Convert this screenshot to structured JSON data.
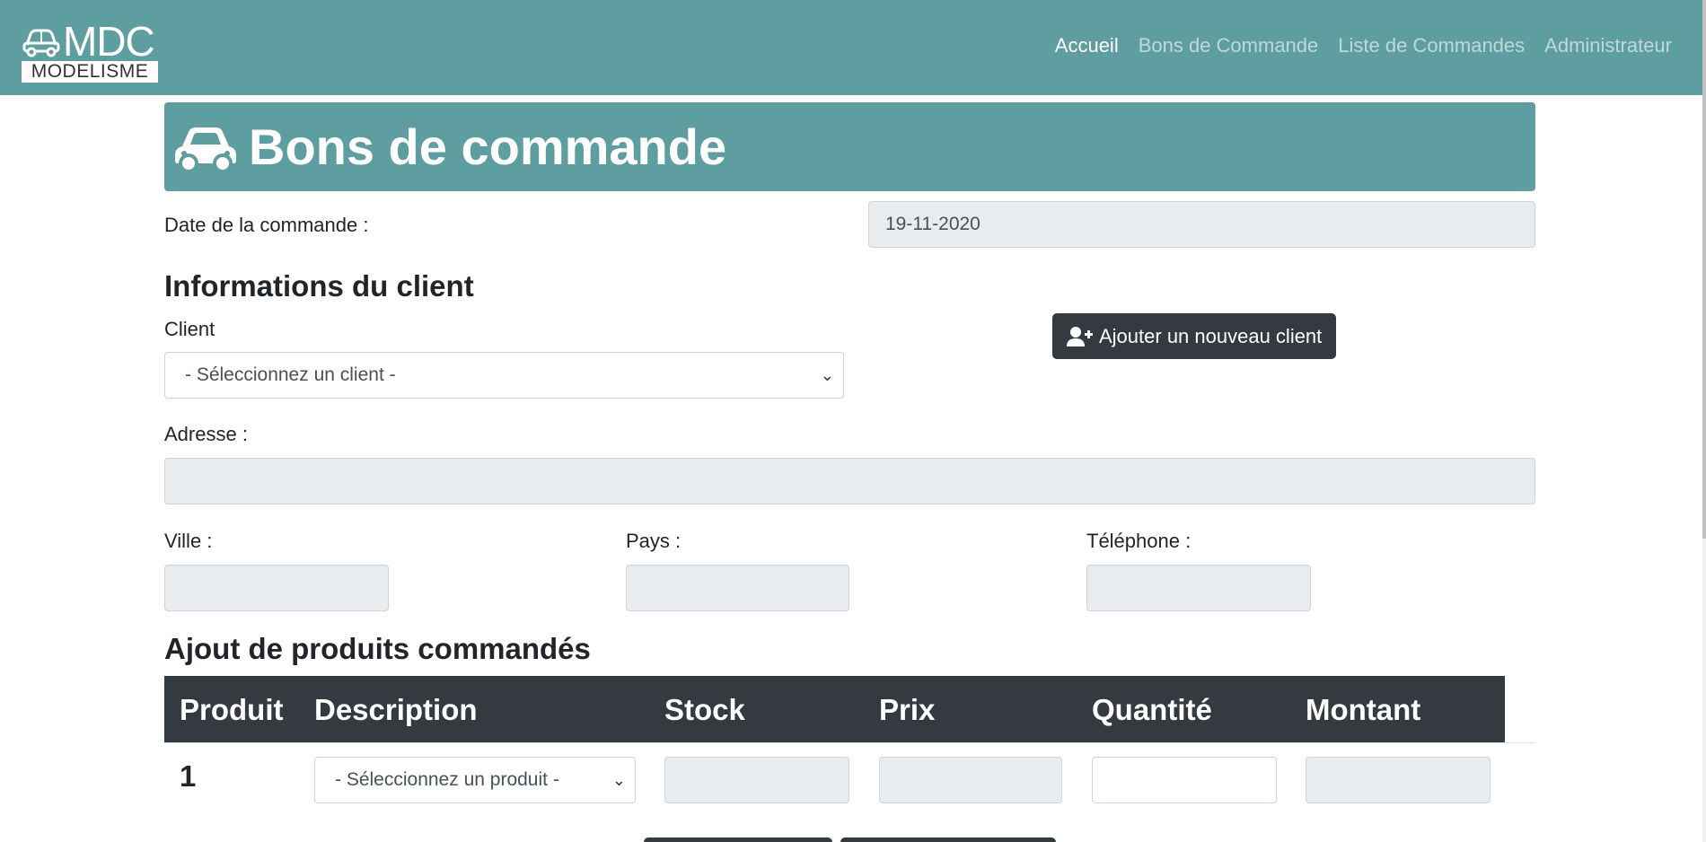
{
  "navbar": {
    "logo_text": "MDC",
    "logo_sub": "MODELISME",
    "links": [
      {
        "label": "Accueil",
        "active": true
      },
      {
        "label": "Bons de Commande",
        "active": false
      },
      {
        "label": "Liste de Commandes",
        "active": false
      },
      {
        "label": "Administrateur",
        "active": false
      }
    ]
  },
  "banner": {
    "icon": "car-icon",
    "title": "Bons de commande"
  },
  "order": {
    "date_label": "Date de la commande :",
    "date_value": "19-11-2020"
  },
  "client_section": {
    "heading": "Informations du client",
    "client_label": "Client",
    "client_select": "- Séleccionnez un client -",
    "add_client_button": "Ajouter un nouveau client",
    "address_label": "Adresse :",
    "address_value": "",
    "city_label": "Ville :",
    "city_value": "",
    "country_label": "Pays :",
    "country_value": "",
    "phone_label": "Téléphone :",
    "phone_value": ""
  },
  "products_section": {
    "heading": "Ajout de produits commandés",
    "columns": [
      "Produit",
      "Description",
      "Stock",
      "Prix",
      "Quantité",
      "Montant"
    ],
    "rows": [
      {
        "number": "1",
        "description": "- Séleccionnez un produit -",
        "stock": "",
        "price": "",
        "quantity": "",
        "amount": ""
      }
    ]
  },
  "colors": {
    "primary": "#5f9ea0",
    "dark": "#343a40",
    "readonly_bg": "#e9ecef"
  }
}
